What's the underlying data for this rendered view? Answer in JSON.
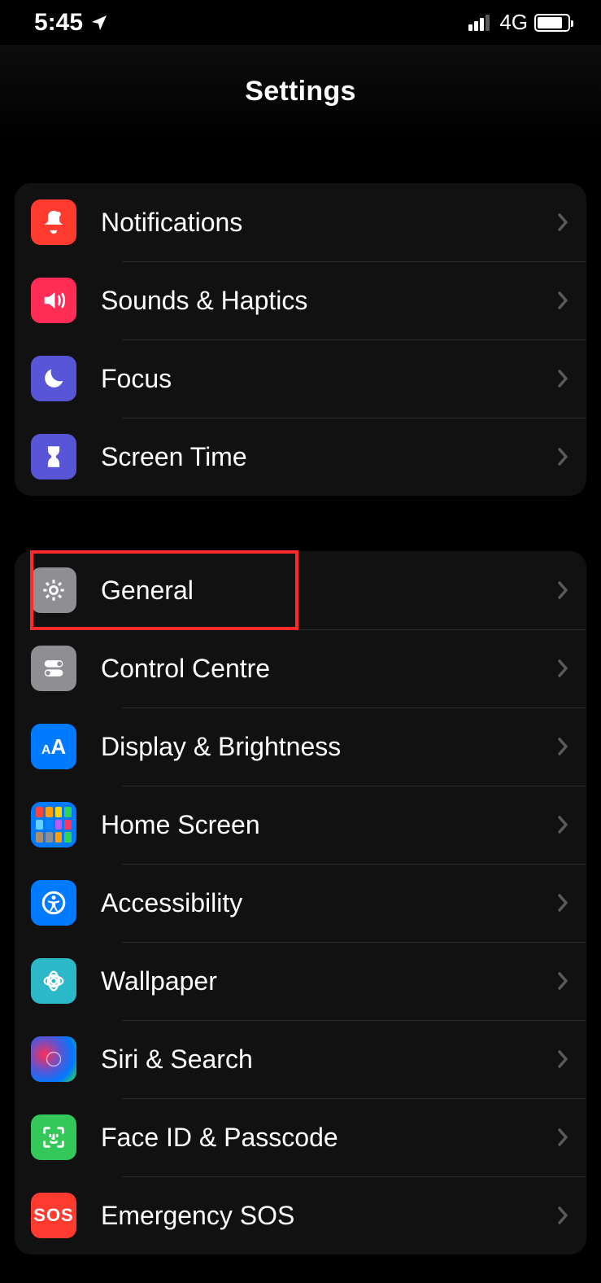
{
  "statusbar": {
    "time": "5:45",
    "network": "4G"
  },
  "header": {
    "title": "Settings"
  },
  "groups": [
    {
      "items": [
        {
          "label": "Notifications"
        },
        {
          "label": "Sounds & Haptics"
        },
        {
          "label": "Focus"
        },
        {
          "label": "Screen Time"
        }
      ]
    },
    {
      "items": [
        {
          "label": "General"
        },
        {
          "label": "Control Centre"
        },
        {
          "label": "Display & Brightness"
        },
        {
          "label": "Home Screen"
        },
        {
          "label": "Accessibility"
        },
        {
          "label": "Wallpaper"
        },
        {
          "label": "Siri & Search"
        },
        {
          "label": "Face ID & Passcode"
        },
        {
          "label": "Emergency SOS"
        }
      ]
    }
  ],
  "highlight": {
    "target": "general"
  }
}
